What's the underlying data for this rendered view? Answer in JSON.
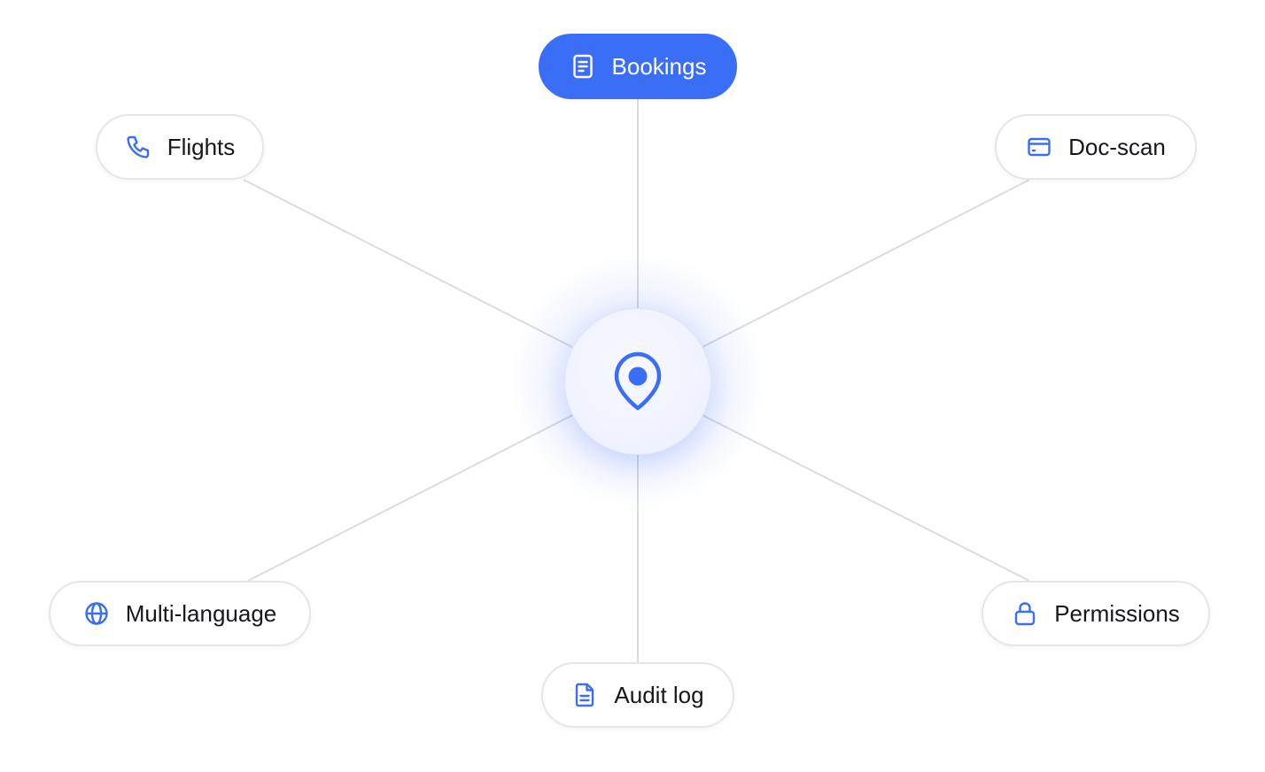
{
  "colors": {
    "accent": "#3b6ef6",
    "connector": "#d9dce3",
    "pill_border": "#e4e6ea",
    "text": "#15171c"
  },
  "hub": {
    "icon": "map-pin-icon"
  },
  "nodes": [
    {
      "id": "bookings",
      "label": "Bookings",
      "icon": "document-list-icon",
      "active": true
    },
    {
      "id": "flights",
      "label": "Flights",
      "icon": "phone-icon",
      "active": false
    },
    {
      "id": "doc-scan",
      "label": "Doc-scan",
      "icon": "card-icon",
      "active": false
    },
    {
      "id": "multi-language",
      "label": "Multi-language",
      "icon": "globe-icon",
      "active": false
    },
    {
      "id": "permissions",
      "label": "Permissions",
      "icon": "lock-icon",
      "active": false
    },
    {
      "id": "audit-log",
      "label": "Audit log",
      "icon": "file-text-icon",
      "active": false
    }
  ]
}
